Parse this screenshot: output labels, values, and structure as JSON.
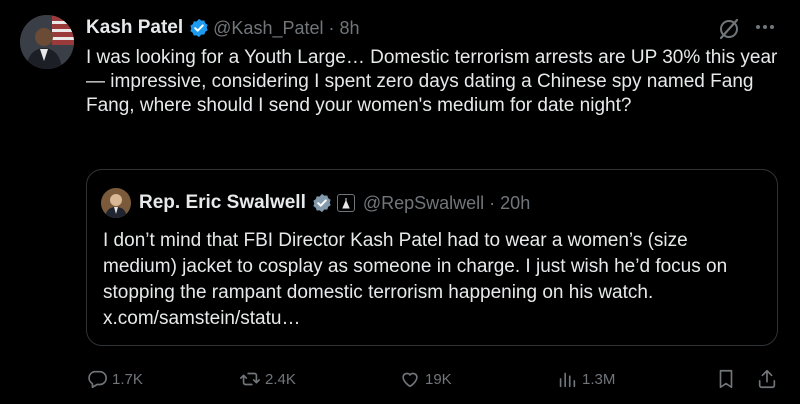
{
  "tweet": {
    "author_name": "Kash Patel",
    "handle": "@Kash_Patel",
    "separator": "·",
    "time": "8h",
    "text": "I was looking for a Youth Large… Domestic terrorism arrests are UP 30% this year — impressive, considering I spent zero days dating a Chinese spy named Fang Fang, where should I send your women's medium for date night?"
  },
  "quote": {
    "author_name": "Rep. Eric Swalwell",
    "handle": "@RepSwalwell",
    "separator": "·",
    "time": "20h",
    "text": "I don’t mind that FBI Director Kash Patel had to wear a women’s (size medium) jacket to cosplay as someone in charge.  I just wish he’d focus on stopping the rampant domestic terrorism happening on his watch.",
    "link": "x.com/samstein/statu…"
  },
  "actions": {
    "replies": "1.7K",
    "reposts": "2.4K",
    "likes": "19K",
    "views": "1.3M"
  },
  "icons": [
    "verified-badge-icon",
    "grok-icon",
    "more-icon",
    "government-badge-icon",
    "reply-icon",
    "repost-icon",
    "like-icon",
    "views-icon",
    "bookmark-icon",
    "share-icon"
  ],
  "colors": {
    "background": "#000000",
    "text": "#e7e9ea",
    "muted": "#71767b",
    "verified": "#1d9bf0",
    "border": "#2f3336"
  }
}
